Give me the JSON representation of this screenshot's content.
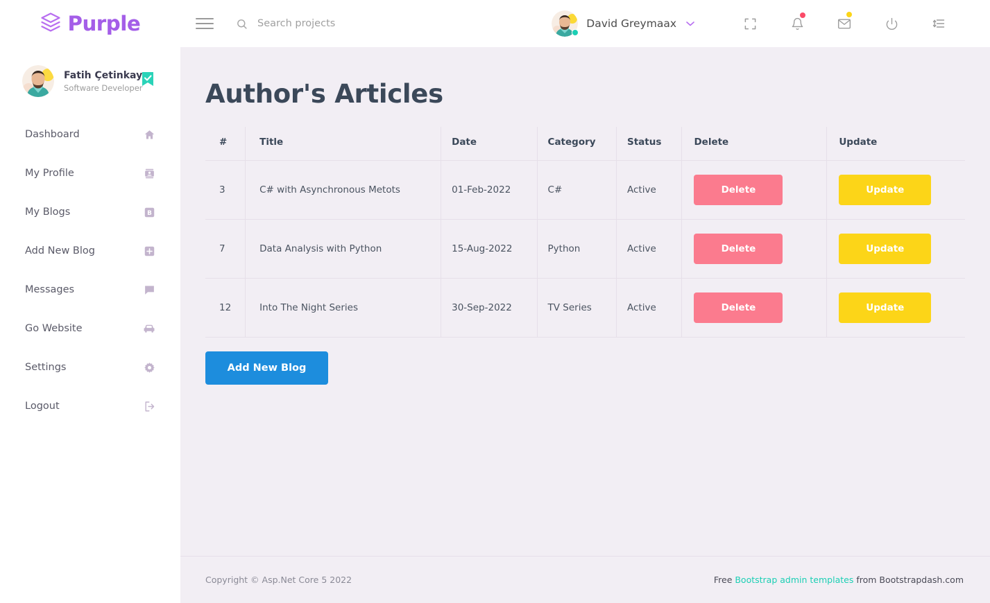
{
  "brand": {
    "name": "Purple",
    "logo_icon": "layers-icon",
    "accent": "#a45ee8"
  },
  "navbar": {
    "menu_toggle_icon": "hamburger-menu-icon",
    "search": {
      "icon": "search-icon",
      "placeholder": "Search projects",
      "value": ""
    },
    "profile": {
      "name": "David Greymaax",
      "chevron_icon": "chevron-down-icon",
      "avatar_icon": "user-avatar",
      "status_dot_color": "#1bcfb4"
    },
    "icons": [
      {
        "name": "fullscreen-icon",
        "badge": null
      },
      {
        "name": "bell-icon",
        "badge": "#fb4b68"
      },
      {
        "name": "envelope-icon",
        "badge": "#fcd518"
      },
      {
        "name": "power-icon",
        "badge": null
      },
      {
        "name": "sort-list-icon",
        "badge": null
      }
    ]
  },
  "sidebar": {
    "profile": {
      "name": "Fatih Çetinkaya",
      "role": "Software Developer",
      "avatar_icon": "user-avatar",
      "verified_icon": "verified-check-badge",
      "verified_color": "#1bcfb4"
    },
    "items": [
      {
        "label": "Dashboard",
        "icon": "home-icon"
      },
      {
        "label": "My Profile",
        "icon": "contact-card-icon"
      },
      {
        "label": "My Blogs",
        "icon": "blog-b-icon"
      },
      {
        "label": "Add New Blog",
        "icon": "plus-square-icon"
      },
      {
        "label": "Messages",
        "icon": "chat-bubble-icon"
      },
      {
        "label": "Go Website",
        "icon": "car-icon"
      },
      {
        "label": "Settings",
        "icon": "gear-icon"
      },
      {
        "label": "Logout",
        "icon": "logout-icon"
      }
    ]
  },
  "main": {
    "title": "Author's Articles",
    "table": {
      "columns": [
        "#",
        "Title",
        "Date",
        "Category",
        "Status",
        "Delete",
        "Update"
      ],
      "rows": [
        {
          "num": "3",
          "title": "C# with Asynchronous Metots",
          "date": "01-Feb-2022",
          "category": "C#",
          "status": "Active",
          "delete_label": "Delete",
          "update_label": "Update"
        },
        {
          "num": "7",
          "title": "Data Analysis with Python",
          "date": "15-Aug-2022",
          "category": "Python",
          "status": "Active",
          "delete_label": "Delete",
          "update_label": "Update"
        },
        {
          "num": "12",
          "title": "Into The Night Series",
          "date": "30-Sep-2022",
          "category": "TV Series",
          "status": "Active",
          "delete_label": "Delete",
          "update_label": "Update"
        }
      ]
    },
    "add_button_label": "Add New Blog",
    "colors": {
      "delete": "#fb7b8e",
      "update": "#fcd518",
      "add": "#1d8ddd"
    }
  },
  "footer": {
    "copyright": "Copyright © Asp.Net Core 5 2022",
    "free_text": "Free ",
    "link_text": "Bootstrap admin templates",
    "from_text": " from Bootstrapdash.com",
    "link_color": "#1bcfb4"
  }
}
